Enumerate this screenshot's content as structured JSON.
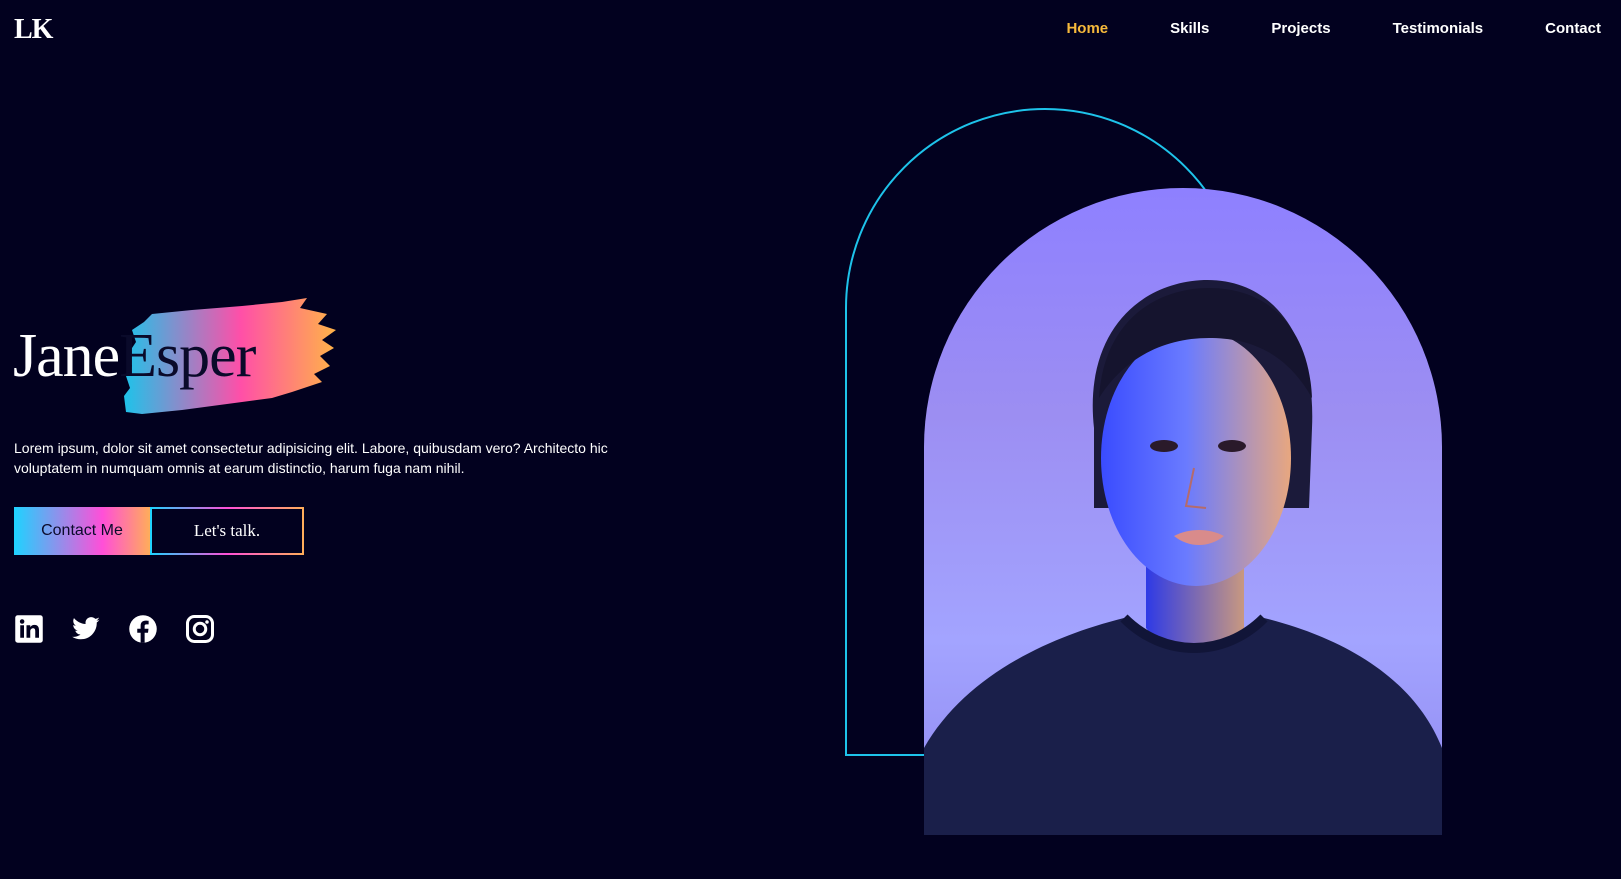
{
  "brand": {
    "logo": "LK"
  },
  "nav": {
    "items": [
      {
        "label": "Home",
        "active": true
      },
      {
        "label": "Skills",
        "active": false
      },
      {
        "label": "Projects",
        "active": false
      },
      {
        "label": "Testimonials",
        "active": false
      },
      {
        "label": "Contact",
        "active": false
      }
    ]
  },
  "hero": {
    "first_name": "Jane",
    "last_name": "Esper",
    "description": "Lorem ipsum, dolor sit amet consectetur adipisicing elit. Labore, quibusdam vero? Architecto hic voluptatem in numquam omnis at earum distinctio, harum fuga nam nihil.",
    "primary_button": "Contact Me",
    "secondary_button": "Let's talk."
  },
  "socials": [
    {
      "icon": "linkedin-icon"
    },
    {
      "icon": "twitter-icon"
    },
    {
      "icon": "facebook-icon"
    },
    {
      "icon": "instagram-icon"
    }
  ],
  "colors": {
    "background": "#02011f",
    "accent_active": "#f6b93b",
    "arch_outline": "#1ec3ea",
    "gradient_start": "#1ed3ff",
    "gradient_mid": "#ff4fd8",
    "gradient_end": "#ffad5a"
  }
}
